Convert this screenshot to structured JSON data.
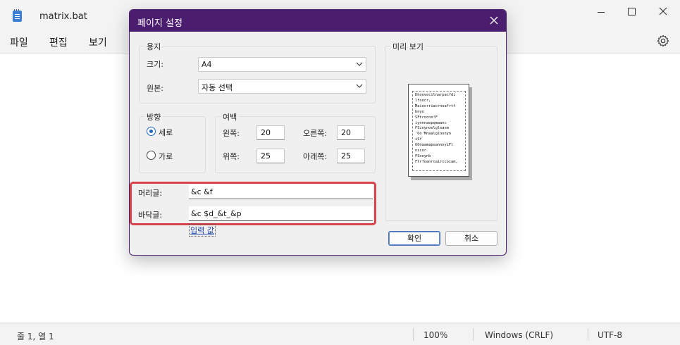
{
  "notepad": {
    "title": "matrix.bat",
    "menu": {
      "file": "파일",
      "edit": "편집",
      "view": "보기"
    },
    "status": {
      "position": "줄 1, 열 1",
      "zoom": "100%",
      "line_ending": "Windows (CRLF)",
      "encoding": "UTF-8"
    }
  },
  "dialog": {
    "title": "페이지 설정",
    "paper": {
      "group_label": "용지",
      "size_label": "크기:",
      "size_value": "A4",
      "source_label": "원본:",
      "source_value": "자동 선택"
    },
    "orientation": {
      "group_label": "방향",
      "portrait_label": "세로",
      "landscape_label": "가로",
      "selected": "portrait"
    },
    "margins": {
      "group_label": "여백",
      "left_label": "왼쪽:",
      "left_value": "20",
      "right_label": "오른쪽:",
      "right_value": "20",
      "top_label": "위쪽:",
      "top_value": "25",
      "bottom_label": "아래쪽:",
      "bottom_value": "25"
    },
    "header_label": "머리글:",
    "header_value": "&c &f",
    "footer_label": "바닥글:",
    "footer_value": "&c $d_&t_&p",
    "input_link": "입력 값",
    "preview": {
      "group_label": "미리 보기",
      "text": "Dhoovecilnarpacfdi\nlfoocr,\nMaiocrriacrnoafrtf\nbnyo\nSFtrocnn!F\niynnnaepqmaanc\nFSinynoelgleanm\n'Oo'Mnaalgloonyn\niSf\nOOnaamapoannnyiFl\nnscor\nFSoeynb\nFtrfoanrcairccoiam,"
    },
    "ok_label": "확인",
    "cancel_label": "취소"
  },
  "colors": {
    "dialog_title_bg": "#4b1d6e",
    "highlight_border": "#d9434a",
    "radio_accent": "#1f67c2"
  }
}
